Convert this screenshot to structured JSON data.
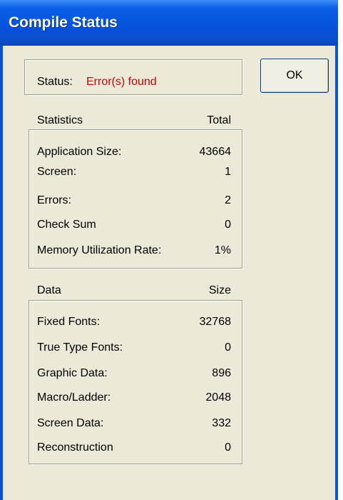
{
  "window": {
    "title": "Compile Status"
  },
  "status": {
    "label": "Status:",
    "value": "Error(s) found"
  },
  "ok_button": "OK",
  "statistics": {
    "header": "Statistics",
    "total_header": "Total",
    "rows": [
      {
        "label": "Application Size:",
        "value": "43664"
      },
      {
        "label": "Screen:",
        "value": "1"
      },
      {
        "label": "Errors:",
        "value": "2"
      },
      {
        "label": "Check Sum",
        "value": "0"
      },
      {
        "label": "Memory Utilization Rate:",
        "value": "1%"
      }
    ]
  },
  "data_section": {
    "header": "Data",
    "size_header": "Size",
    "rows": [
      {
        "label": "Fixed Fonts:",
        "value": "32768"
      },
      {
        "label": "True Type Fonts:",
        "value": "0"
      },
      {
        "label": "Graphic Data:",
        "value": "896"
      },
      {
        "label": "Macro/Ladder:",
        "value": "2048"
      },
      {
        "label": "Screen Data:",
        "value": "332"
      },
      {
        "label": "Reconstruction",
        "value": "0"
      }
    ]
  }
}
